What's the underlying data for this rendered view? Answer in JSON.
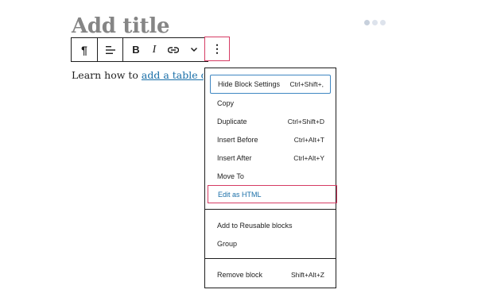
{
  "editor": {
    "title_placeholder": "Add title",
    "paragraph": {
      "prefix": "Learn how to ",
      "link_text": "add a table of contents"
    }
  },
  "toolbar": {
    "icons": {
      "paragraph": "¶",
      "align": "align-left-icon",
      "bold": "B",
      "italic": "I",
      "link": "link-icon",
      "more_rich": "chevron-down-icon",
      "options": "⋮"
    }
  },
  "menu": {
    "items": [
      {
        "label": "Hide Block Settings",
        "shortcut": "Ctrl+Shift+,"
      },
      {
        "label": "Copy",
        "shortcut": ""
      },
      {
        "label": "Duplicate",
        "shortcut": "Ctrl+Shift+D"
      },
      {
        "label": "Insert Before",
        "shortcut": "Ctrl+Alt+T"
      },
      {
        "label": "Insert After",
        "shortcut": "Ctrl+Alt+Y"
      },
      {
        "label": "Move To",
        "shortcut": ""
      },
      {
        "label": "Edit as HTML",
        "shortcut": ""
      },
      {
        "label": "Add to Reusable blocks",
        "shortcut": ""
      },
      {
        "label": "Group",
        "shortcut": ""
      },
      {
        "label": "Remove block",
        "shortcut": "Shift+Alt+Z"
      }
    ]
  },
  "colors": {
    "highlight_border": "#d63c64",
    "focus_border": "#3f87c2",
    "link": "#1a6fa8",
    "title": "#858585"
  }
}
